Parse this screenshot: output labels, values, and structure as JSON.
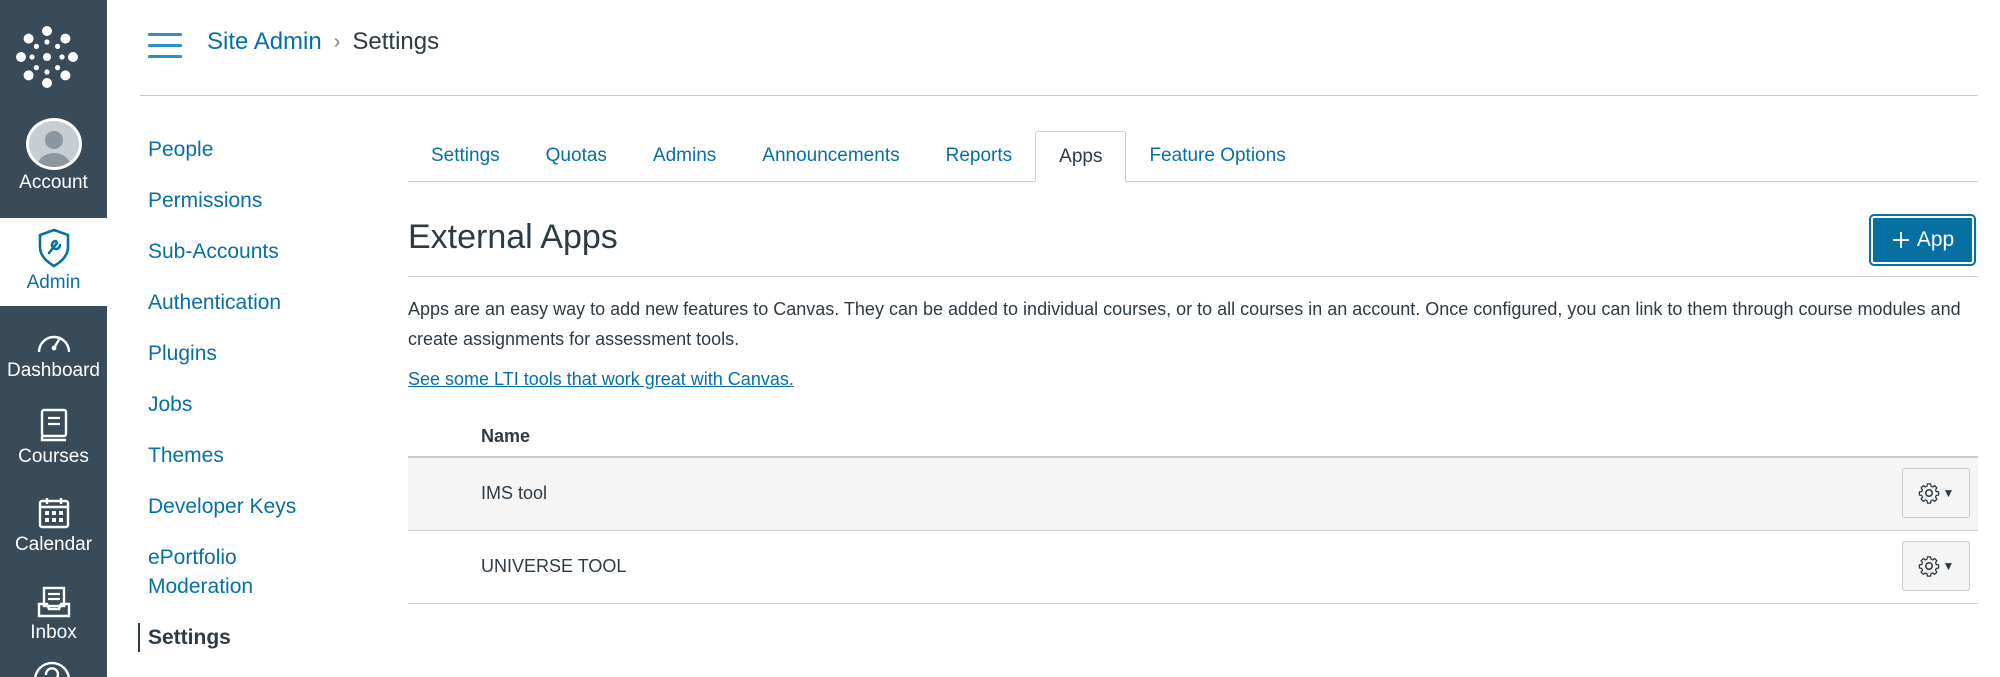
{
  "global_nav": {
    "items": [
      {
        "label": "Account",
        "icon": "avatar-icon",
        "active": false
      },
      {
        "label": "Admin",
        "icon": "shield-wrench-icon",
        "active": true
      },
      {
        "label": "Dashboard",
        "icon": "speedometer-icon",
        "active": false
      },
      {
        "label": "Courses",
        "icon": "book-icon",
        "active": false
      },
      {
        "label": "Calendar",
        "icon": "calendar-icon",
        "active": false
      },
      {
        "label": "Inbox",
        "icon": "inbox-icon",
        "active": false
      }
    ]
  },
  "breadcrumb": {
    "root": "Site Admin",
    "separator": "›",
    "current": "Settings"
  },
  "left_nav": {
    "items": [
      {
        "label": "People"
      },
      {
        "label": "Permissions"
      },
      {
        "label": "Sub-Accounts"
      },
      {
        "label": "Authentication"
      },
      {
        "label": "Plugins"
      },
      {
        "label": "Jobs"
      },
      {
        "label": "Themes"
      },
      {
        "label": "Developer Keys"
      },
      {
        "label": "ePortfolio Moderation"
      },
      {
        "label": "Settings",
        "active": true
      }
    ]
  },
  "tabs": [
    {
      "label": "Settings"
    },
    {
      "label": "Quotas"
    },
    {
      "label": "Admins"
    },
    {
      "label": "Announcements"
    },
    {
      "label": "Reports"
    },
    {
      "label": "Apps",
      "active": true
    },
    {
      "label": "Feature Options"
    }
  ],
  "main": {
    "title": "External Apps",
    "add_button_label": "App",
    "description": "Apps are an easy way to add new features to Canvas. They can be added to individual courses, or to all courses in an account. Once configured, you can link to them through course modules and create assignments for assessment tools.",
    "lti_link": "See some LTI tools that work great with Canvas.",
    "table": {
      "columns": [
        "Name"
      ],
      "rows": [
        {
          "name": "IMS tool"
        },
        {
          "name": "UNIVERSE TOOL"
        }
      ]
    }
  },
  "colors": {
    "nav_bg": "#394b58",
    "link": "#0770a3",
    "text": "#2d3b45",
    "border": "#c7cdd1"
  }
}
